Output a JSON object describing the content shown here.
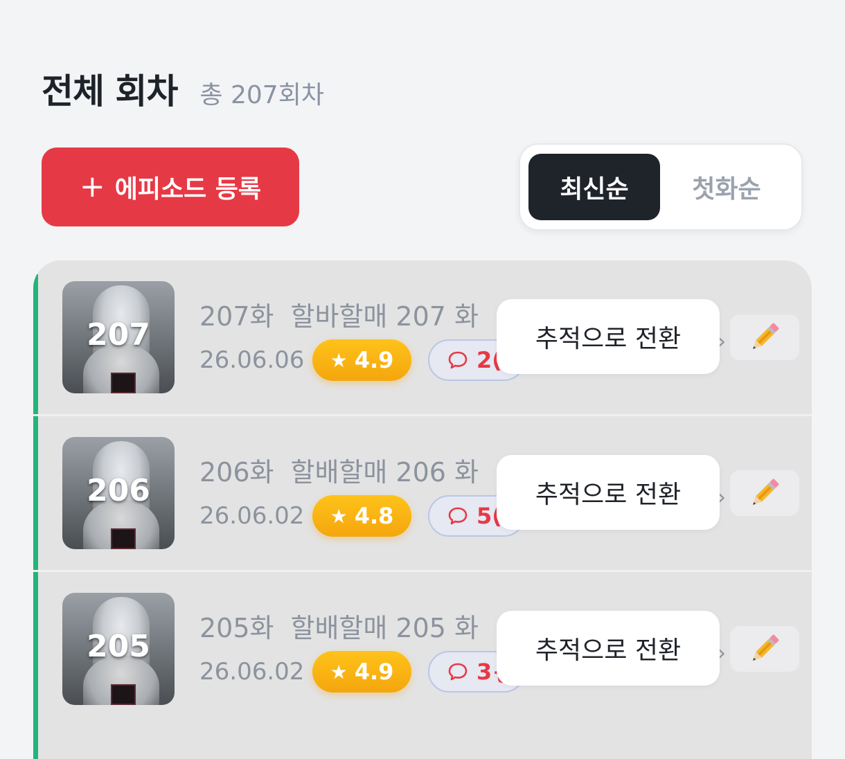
{
  "header": {
    "title": "전체 회차",
    "subtitle": "총 207회차"
  },
  "add_button": {
    "plus": "+",
    "label": "에피소드 등록"
  },
  "sort": {
    "options": [
      "최신순",
      "첫화순"
    ],
    "active": "최신순"
  },
  "colors": {
    "accent": "#e63946",
    "rating": "#f4a60d",
    "active_tab": "#1f232a",
    "side_bar": "#22b57a"
  },
  "episodes": [
    {
      "thumb_number": "207",
      "number_label": "207화",
      "name": "할바할매 207 화",
      "date": "26.06.06",
      "rating": "4.9",
      "comment_count": "2(",
      "tooltip": "추적으로 전환",
      "chevron": "›",
      "edit_icon": "pencil-icon"
    },
    {
      "thumb_number": "206",
      "number_label": "206화",
      "name": "할배할매 206 화",
      "date": "26.06.02",
      "rating": "4.8",
      "comment_count": "5(",
      "tooltip": "추적으로 전환",
      "chevron": "›",
      "edit_icon": "pencil-icon"
    },
    {
      "thumb_number": "205",
      "number_label": "205화",
      "name": "할배할매 205 화",
      "date": "26.06.02",
      "rating": "4.9",
      "comment_count": "3{",
      "tooltip": "추적으로 전환",
      "chevron": "›",
      "edit_icon": "pencil-icon"
    }
  ],
  "icons": {
    "rating": "star-icon",
    "comment": "speech-bubble-icon",
    "edit": "pencil-icon"
  }
}
